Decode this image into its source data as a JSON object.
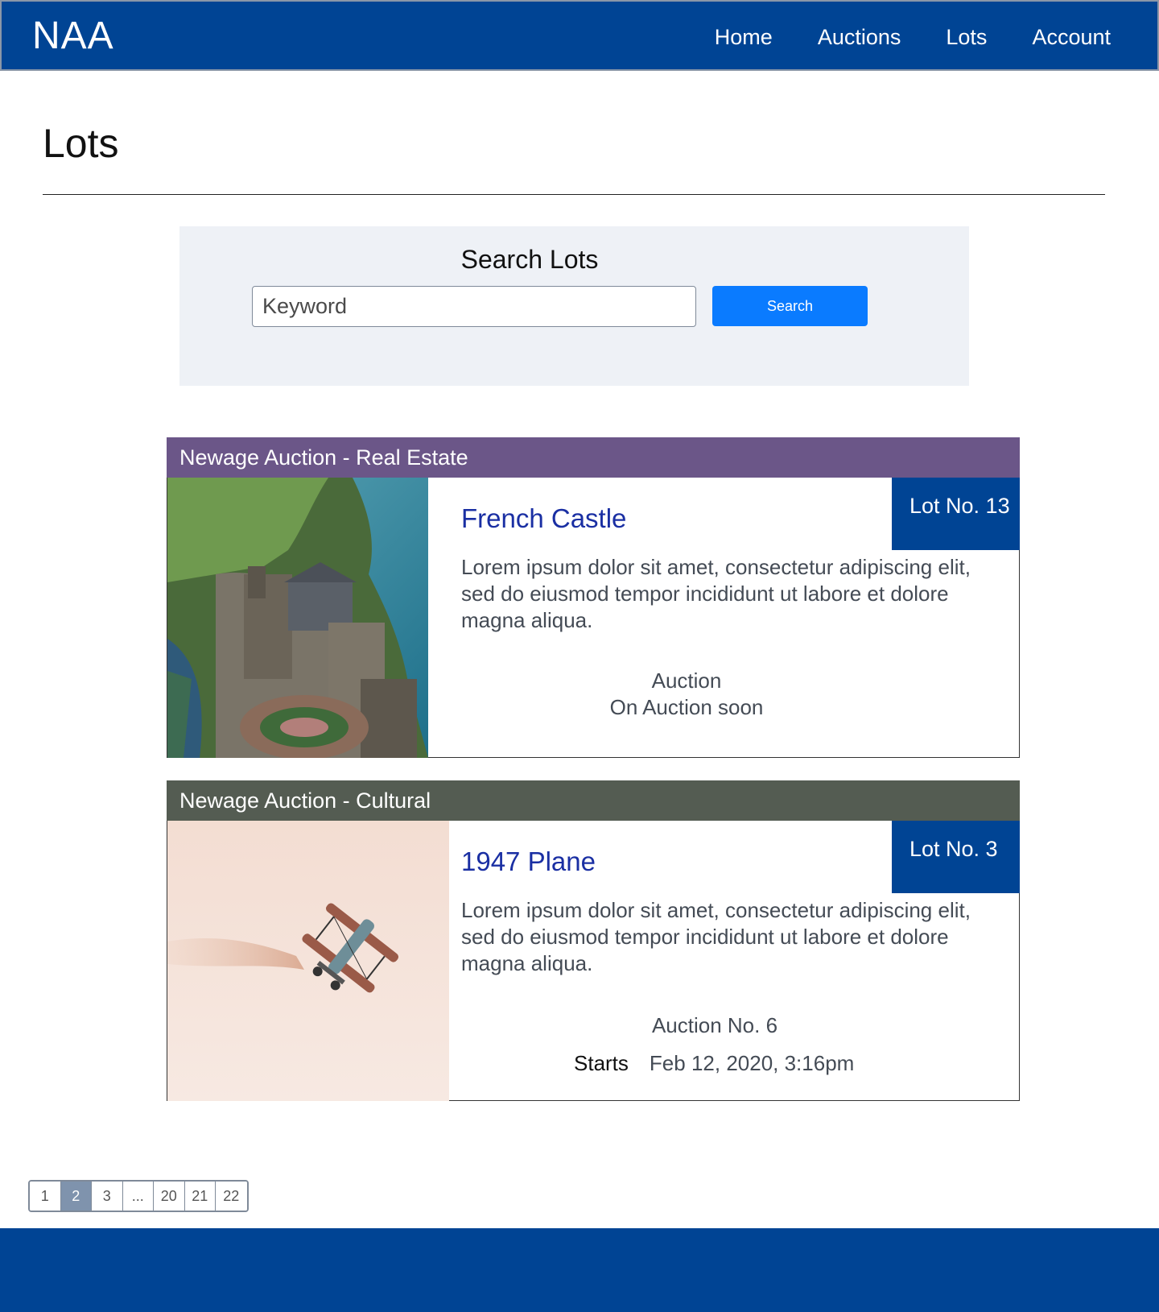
{
  "header": {
    "brand": "NAA",
    "nav": [
      "Home",
      "Auctions",
      "Lots",
      "Account"
    ]
  },
  "page": {
    "title": "Lots"
  },
  "search": {
    "title": "Search Lots",
    "placeholder": "Keyword",
    "button_label": "Search"
  },
  "lots": [
    {
      "auction_name": "Newage Auction - Real Estate",
      "header_color": "#6b5688",
      "lot_number": "Lot No. 13",
      "name": "French Castle",
      "description": "Lorem ipsum dolor sit amet, consectetur adipiscing elit, sed do eiusmod tempor incididunt ut labore et dolore magna aliqua.",
      "auction_label": "Auction",
      "auction_status": "On Auction soon"
    },
    {
      "auction_name": "Newage Auction - Cultural",
      "header_color": "#545c52",
      "lot_number": "Lot No. 3",
      "name": "1947 Plane",
      "description": "Lorem ipsum dolor sit amet, consectetur adipiscing elit, sed do eiusmod tempor incididunt ut labore et dolore magna aliqua.",
      "auction_label": "Auction No. 6",
      "starts_label": "Starts",
      "starts_value": "Feb 12, 2020, 3:16pm"
    }
  ],
  "pagination": {
    "pages": [
      "1",
      "2",
      "3",
      "...",
      "20",
      "21",
      "22"
    ],
    "current": "2"
  },
  "colors": {
    "brand_blue": "#004494",
    "search_button": "#0a7bff",
    "lot_link": "#1a2fa3"
  }
}
